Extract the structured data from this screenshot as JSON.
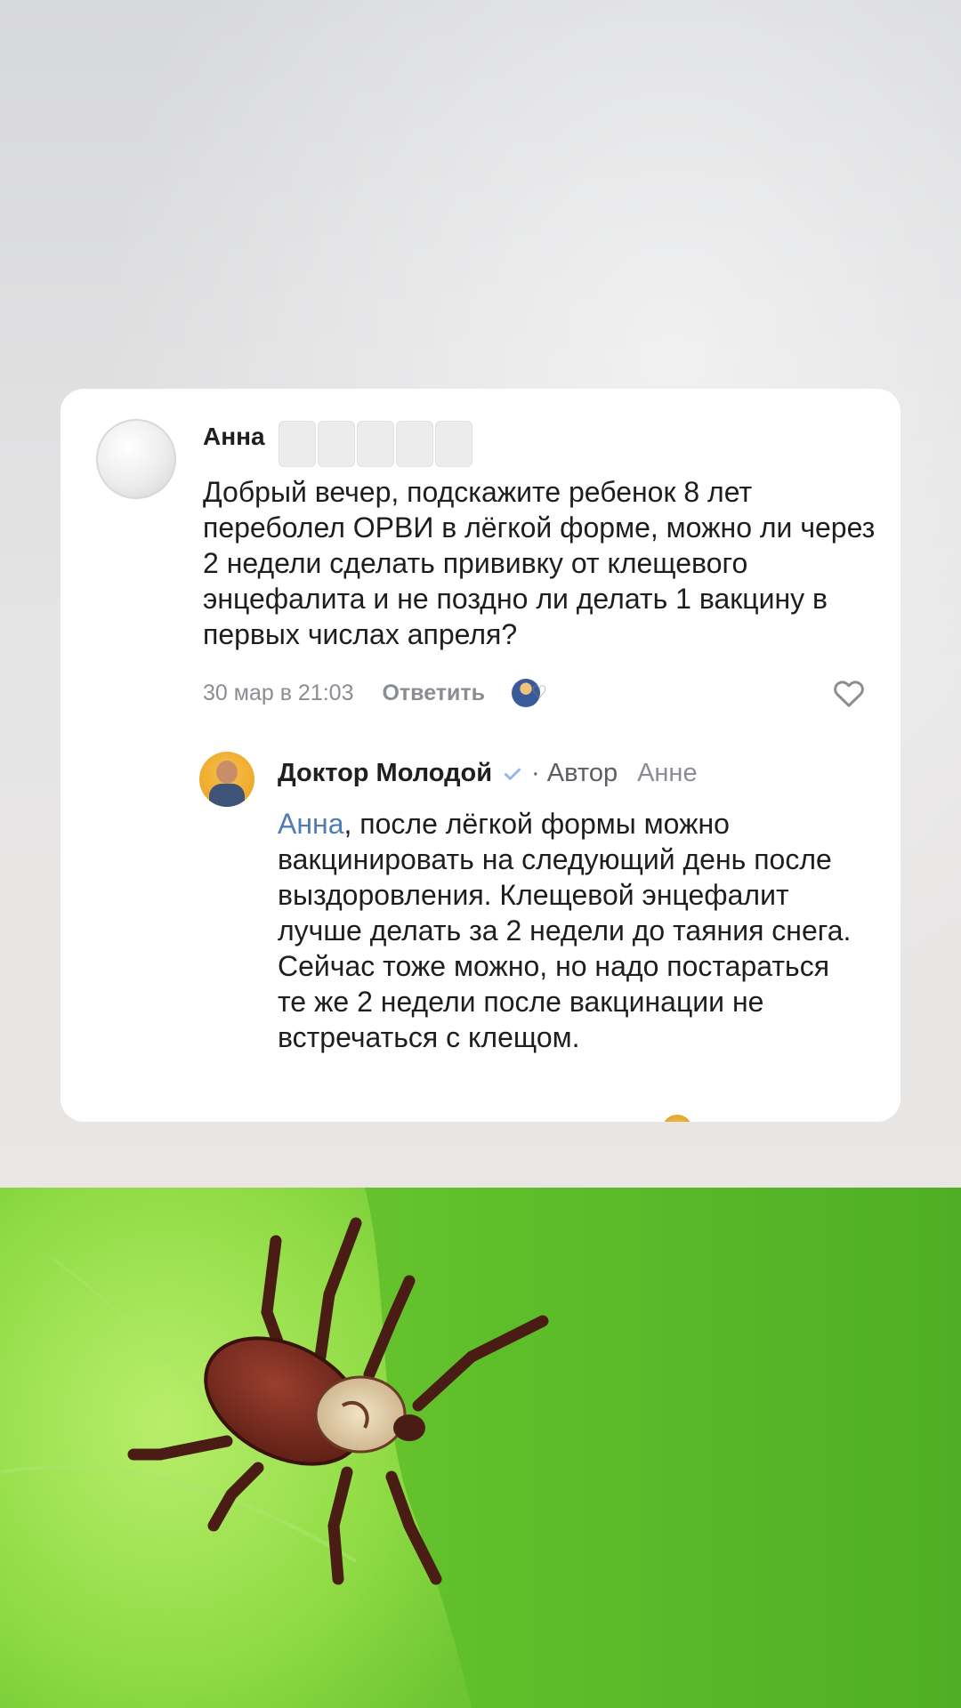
{
  "comment": {
    "author": "Анна",
    "text": "Добрый вечер, подскажите ребенок 8 лет переболел ОРВИ в лёгкой форме, можно ли через 2 недели сделать прививку от клещевого энцефалита и не поздно ли делать 1 вакцину в первых числах апреля?",
    "timestamp": "30 мар в 21:03",
    "reply_label": "Ответить"
  },
  "reply": {
    "author": "Доктор Молодой",
    "role": "· Автор",
    "reply_to": "Анне",
    "mention": "Анна",
    "text": ", после лёгкой формы можно вакцинировать на следующий день после выздоровления. Клещевой энцефалит лучше делать за 2 недели до таяния снега. Сейчас тоже можно, но надо постараться те же 2 недели после вакцинации не встречаться с клещом."
  },
  "icons": {
    "like": "heart-outline-icon",
    "liked_by_author": "author-liked-heart-icon",
    "verified": "verified-check-icon"
  },
  "colors": {
    "mention": "#4f7cb5",
    "verified": "#8fb6e8",
    "meta_text": "#8a8d92"
  }
}
